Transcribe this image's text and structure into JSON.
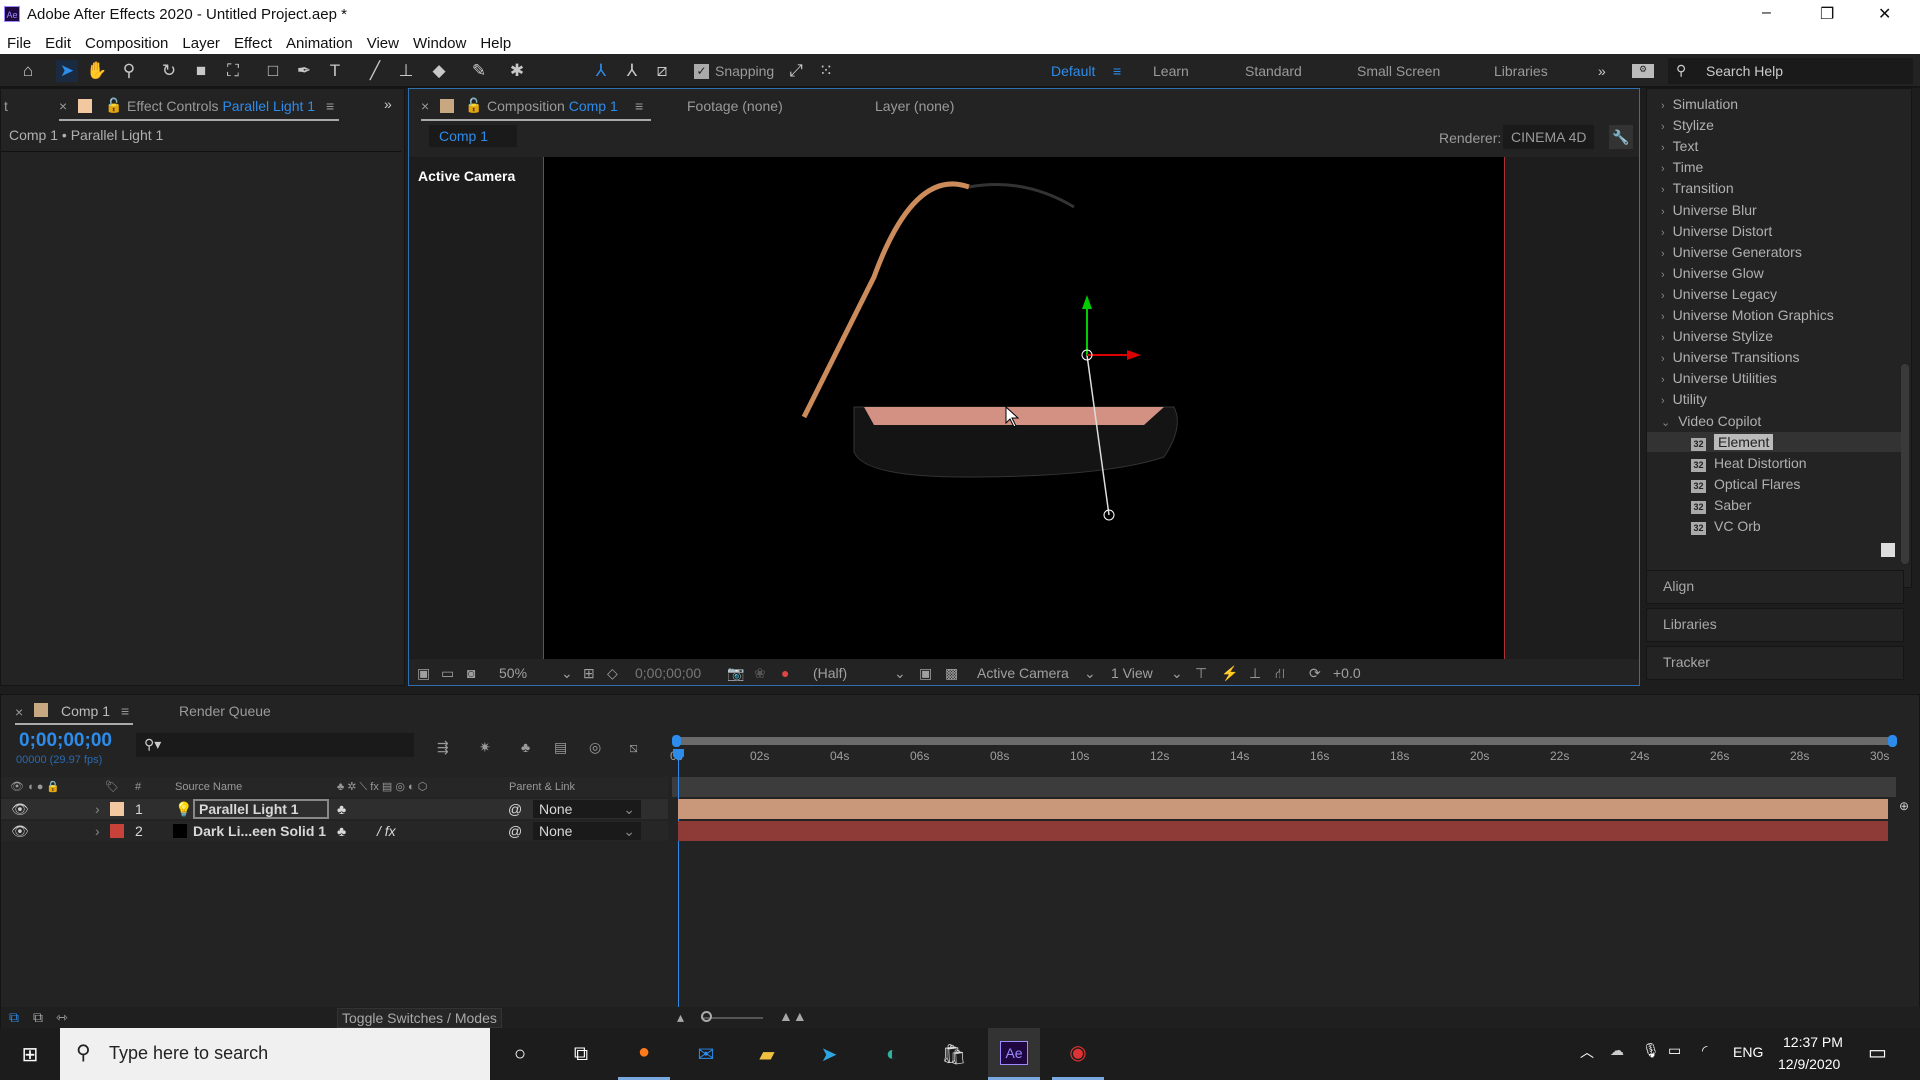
{
  "window": {
    "title": "Adobe After Effects 2020 - Untitled Project.aep *",
    "app_icon": "Ae",
    "controls": {
      "minimize": "–",
      "maximize": "❐",
      "close": "✕"
    }
  },
  "menu": [
    "File",
    "Edit",
    "Composition",
    "Layer",
    "Effect",
    "Animation",
    "View",
    "Window",
    "Help"
  ],
  "toolbar": {
    "snapping_label": "Snapping",
    "snapping_checked": true,
    "workspaces": [
      "Default",
      "Learn",
      "Standard",
      "Small Screen",
      "Libraries"
    ],
    "active_workspace": "Default",
    "search_help_placeholder": "Search Help"
  },
  "effect_controls": {
    "tab_prefix": "Effect Controls",
    "tab_layer": "Parallel Light 1",
    "left_tab_stub": "t",
    "breadcrumb": "Comp 1 • Parallel Light 1"
  },
  "composition": {
    "tab_prefix": "Composition",
    "tab_comp": "Comp 1",
    "footage_tab": "Footage  (none)",
    "layer_tab": "Layer  (none)",
    "comp_chip": "Comp 1",
    "renderer_label": "Renderer:",
    "renderer_value": "CINEMA 4D",
    "view_label": "Active Camera",
    "bottom": {
      "zoom": "50%",
      "timecode": "0;00;00;00",
      "resolution": "(Half)",
      "camera": "Active Camera",
      "views": "1 View",
      "exposure": "+0.0"
    }
  },
  "effects_panel": {
    "categories": [
      "Simulation",
      "Stylize",
      "Text",
      "Time",
      "Transition",
      "Universe Blur",
      "Universe Distort",
      "Universe Generators",
      "Universe Glow",
      "Universe Legacy",
      "Universe Motion Graphics",
      "Universe Stylize",
      "Universe Transitions",
      "Universe Utilities",
      "Utility"
    ],
    "expanded": "Video Copilot",
    "bit_badge": "32",
    "sub_items": [
      "Element",
      "Heat Distortion",
      "Optical Flares",
      "Saber",
      "VC Orb"
    ],
    "selected": "Element",
    "collapsed_panels": [
      "Align",
      "Libraries",
      "Tracker"
    ]
  },
  "timeline": {
    "tab": "Comp 1",
    "render_queue_tab": "Render Queue",
    "timecode": "0;00;00;00",
    "frame_info": "00000 (29.97 fps)",
    "search_placeholder": "",
    "columns": {
      "number": "#",
      "source_name": "Source Name",
      "parent": "Parent & Link"
    },
    "ruler_ticks": [
      "0s",
      "02s",
      "04s",
      "06s",
      "08s",
      "10s",
      "12s",
      "14s",
      "16s",
      "18s",
      "20s",
      "22s",
      "24s",
      "26s",
      "28s",
      "30s"
    ],
    "layers": [
      {
        "number": "1",
        "name": "Parallel Light 1",
        "label_color": "#f2c8a0",
        "bar_color": "#c9987a",
        "parent": "None",
        "has_fx": false
      },
      {
        "number": "2",
        "name": "Dark Li...een Solid 1",
        "label_color": "#c8423a",
        "bar_color": "#8e3b37",
        "parent": "None",
        "has_fx": true
      }
    ],
    "fx_label": "fx",
    "toggle_label": "Toggle Switches / Modes"
  },
  "taskbar": {
    "search_placeholder": "Type here to search",
    "time": "12:37 PM",
    "date": "12/9/2020",
    "language": "ENG",
    "apps": [
      "cortana",
      "task-view",
      "firefox",
      "mail",
      "file-explorer",
      "telegram",
      "edge",
      "store",
      "after-effects",
      "screen-recorder"
    ],
    "active_app": "Ae"
  },
  "colors": {
    "accent": "#2d8ceb",
    "panel_bg": "#232323",
    "viewer_bg": "#000000"
  }
}
